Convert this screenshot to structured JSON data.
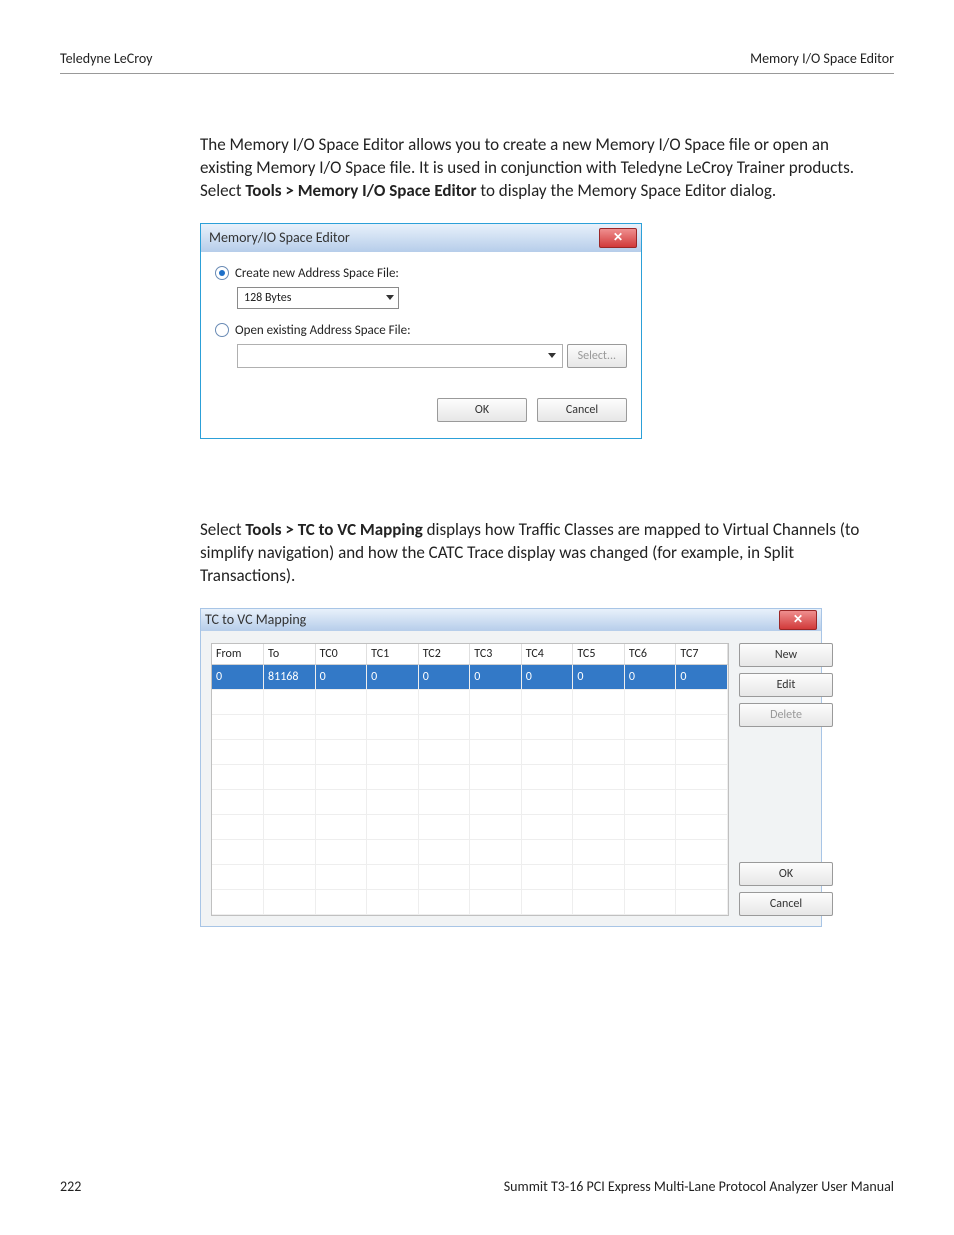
{
  "header": {
    "left": "Teledyne LeCroy",
    "right": "Memory I/O Space Editor"
  },
  "para1": {
    "pre": "The Memory I/O Space Editor allows you to create a new Memory I/O Space file or open an existing Memory I/O Space file. It is used in conjunction with Teledyne LeCroy Trainer products. Select ",
    "bold": "Tools > Memory I/O Space Editor",
    "post": " to display the Memory Space Editor dialog."
  },
  "dlg1": {
    "title": "Memory/IO Space Editor",
    "optCreate": "Create new Address Space File:",
    "sizeValue": "128 Bytes",
    "optOpen": "Open existing Address Space File:",
    "selectBtn": "Select...",
    "ok": "OK",
    "cancel": "Cancel"
  },
  "para2": {
    "pre": "Select ",
    "bold": "Tools > TC to VC Mapping",
    "post": " displays how Traffic Classes are mapped to Virtual Channels (to simplify navigation) and how the CATC Trace display was changed (for example, in Split Transactions)."
  },
  "dlg2": {
    "title": "TC to VC Mapping",
    "cols": [
      "From",
      "To",
      "TC0",
      "TC1",
      "TC2",
      "TC3",
      "TC4",
      "TC5",
      "TC6",
      "TC7"
    ],
    "row": [
      "0",
      "81168",
      "0",
      "0",
      "0",
      "0",
      "0",
      "0",
      "0",
      "0"
    ],
    "buttons": {
      "new": "New",
      "edit": "Edit",
      "del": "Delete",
      "ok": "OK",
      "cancel": "Cancel"
    }
  },
  "footer": {
    "left": "222",
    "right": "Summit T3-16 PCI Express Multi-Lane Protocol Analyzer User Manual"
  }
}
